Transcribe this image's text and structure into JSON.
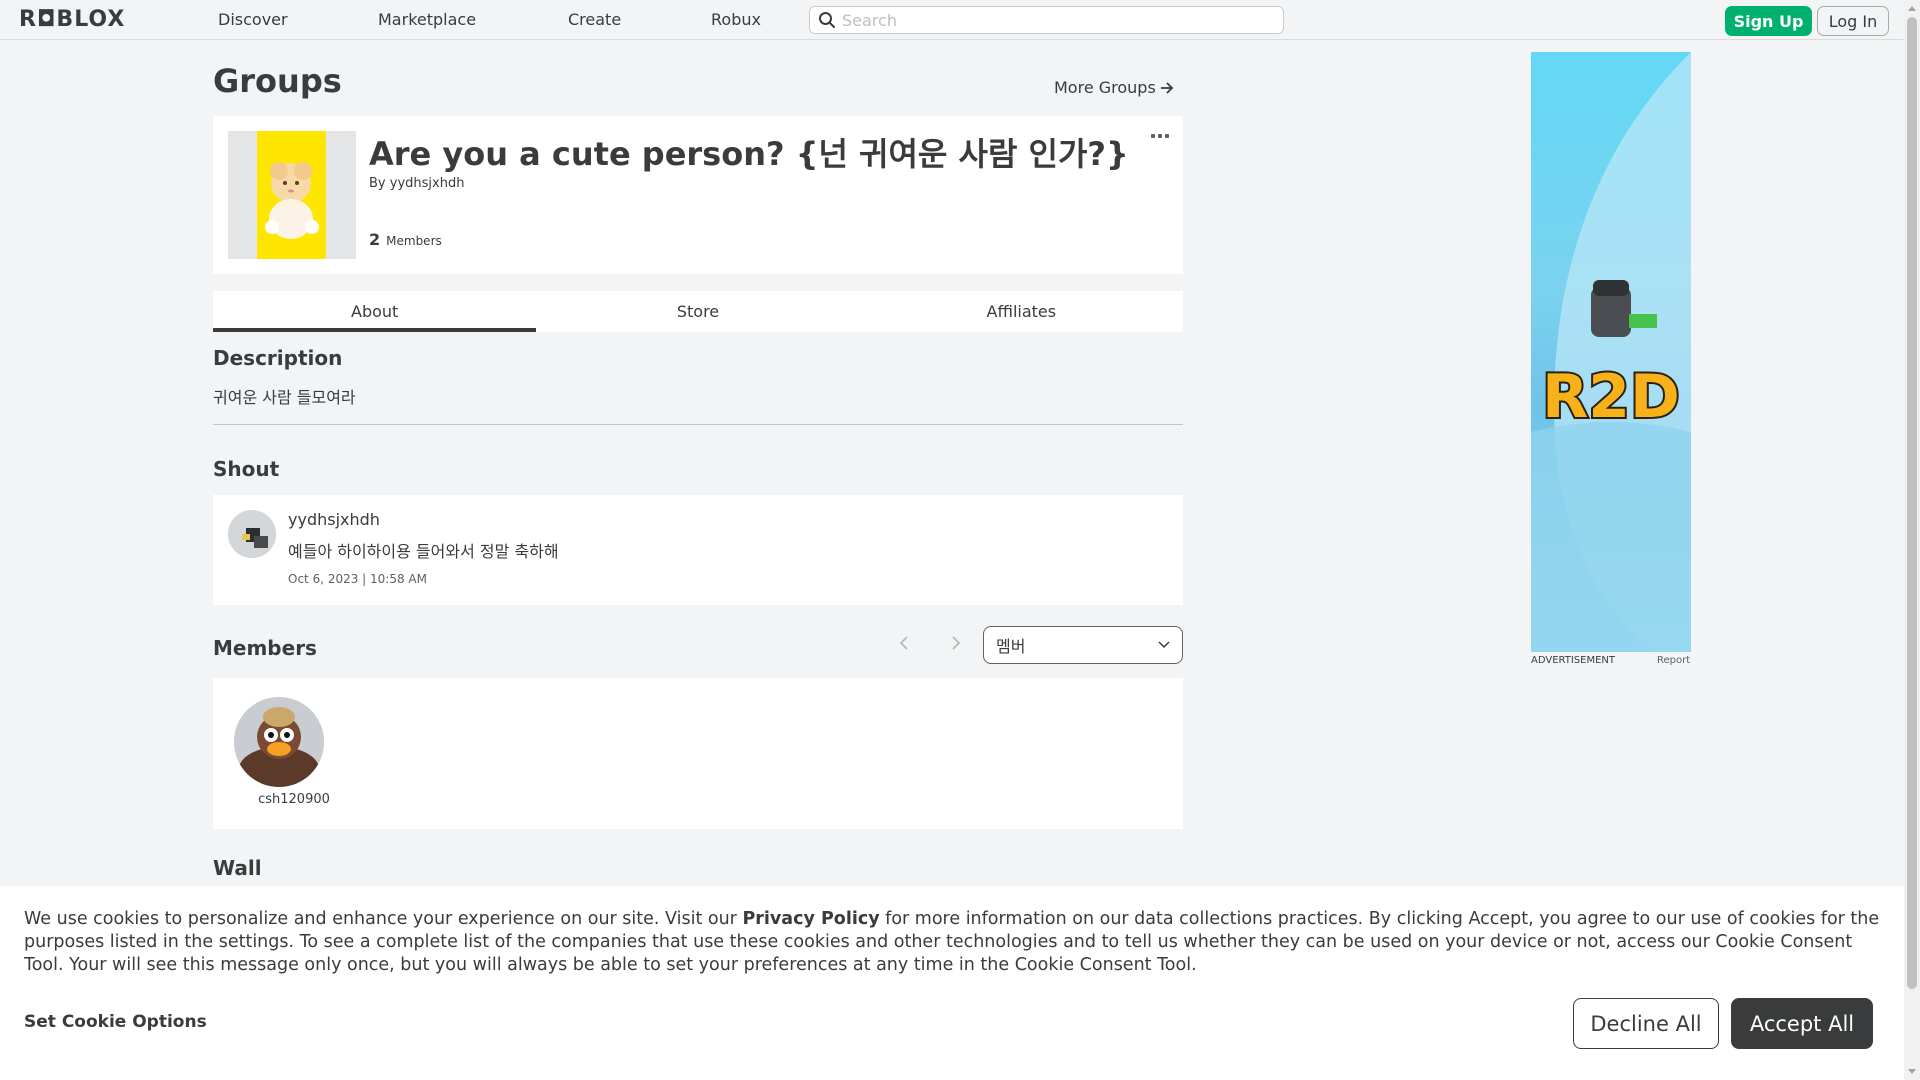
{
  "header": {
    "logo": "R◘BLOX",
    "nav": [
      "Discover",
      "Marketplace",
      "Create",
      "Robux"
    ],
    "search_placeholder": "Search",
    "signup_label": "Sign Up",
    "login_label": "Log In"
  },
  "page": {
    "title": "Groups",
    "more_groups": "More Groups"
  },
  "group": {
    "name": "Are you a cute person? {넌 귀여운 사람 인가?}",
    "by_label": "By",
    "owner": "yydhsjxhdh",
    "member_count": "2",
    "members_label": "Members"
  },
  "tabs": [
    "About",
    "Store",
    "Affiliates"
  ],
  "description": {
    "title": "Description",
    "text": "귀여운 사람 들모여라"
  },
  "shout": {
    "title": "Shout",
    "user": "yydhsjxhdh",
    "body": "예들아 하이하이용 들어와서 정말 축하해",
    "date": "Oct 6, 2023 | 10:58 AM"
  },
  "members": {
    "title": "Members",
    "role_selected": "멤버",
    "list": [
      {
        "name": "csh120900"
      }
    ]
  },
  "wall": {
    "title": "Wall"
  },
  "ad": {
    "logo_text": "R2D",
    "label": "ADVERTISEMENT",
    "report": "Report"
  },
  "cookie": {
    "text_before": "We use cookies to personalize and enhance your experience on our site. Visit our ",
    "privacy_link": "Privacy Policy",
    "text_after": " for more information on our data collections practices. By clicking Accept, you agree to our use of cookies for the purposes listed in the settings. To see a complete list of the companies that use these cookies and other technologies and to tell us whether they can be used on your device or not, access our Cookie Consent Tool. Your will see this message only once, but you will always be able to set your preferences at any time in the Cookie Consent Tool.",
    "settings_label": "Set Cookie Options",
    "decline_label": "Decline All",
    "accept_label": "Accept All"
  },
  "colors": {
    "accent_green": "#00b06f",
    "text_primary": "#393b3d",
    "background": "#f2f4f5"
  }
}
